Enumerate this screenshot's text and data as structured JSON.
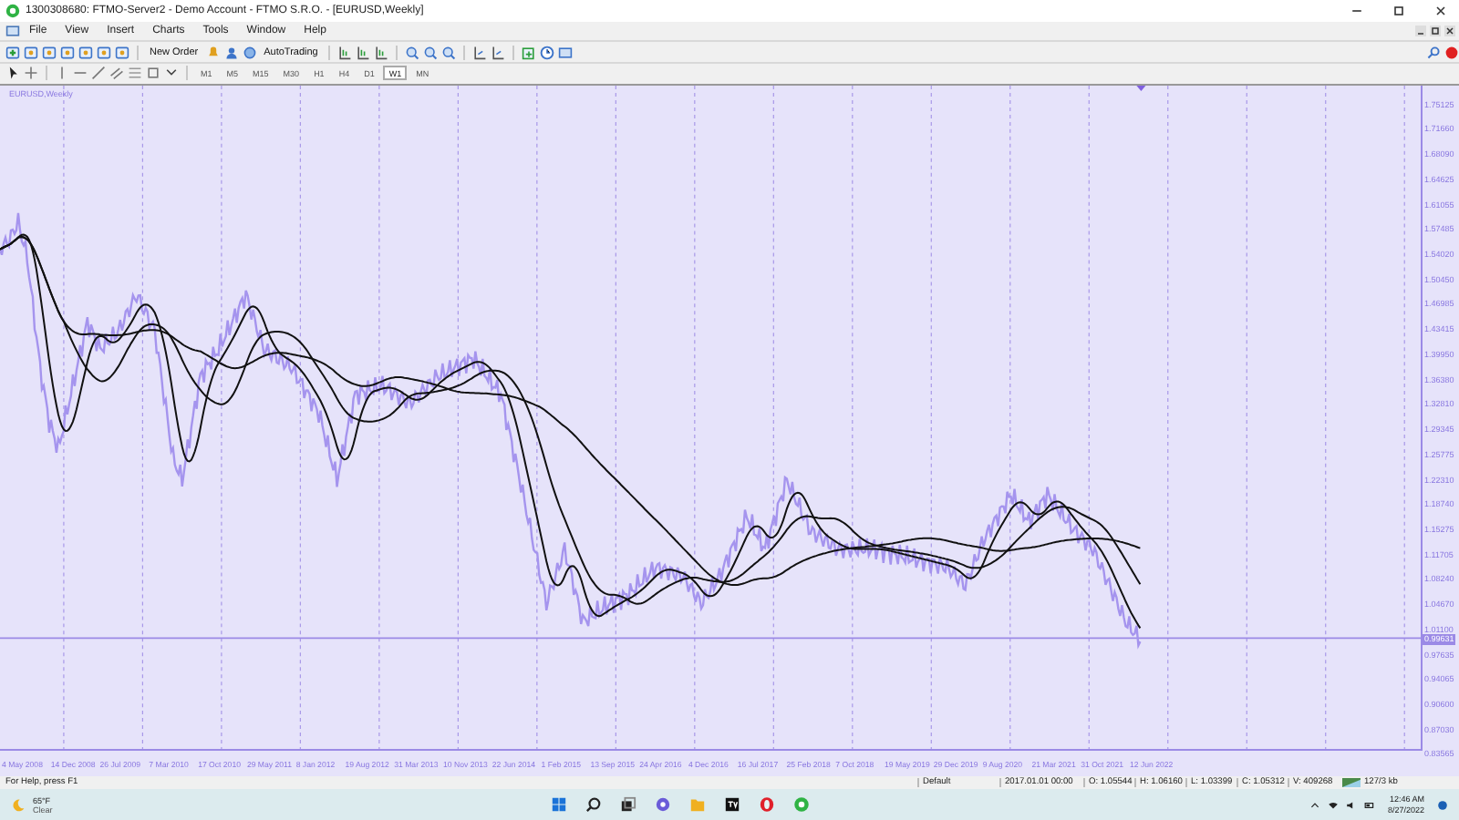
{
  "window": {
    "title": "1300308680: FTMO-Server2 - Demo Account - FTMO S.R.O. - [EURUSD,Weekly]"
  },
  "menu": [
    "File",
    "View",
    "Insert",
    "Charts",
    "Tools",
    "Window",
    "Help"
  ],
  "toolbar": {
    "new_order": "New Order",
    "auto_trading": "AutoTrading"
  },
  "timeframes": [
    {
      "label": "M1",
      "selected": false
    },
    {
      "label": "M5",
      "selected": false
    },
    {
      "label": "M15",
      "selected": false
    },
    {
      "label": "M30",
      "selected": false
    },
    {
      "label": "H1",
      "selected": false
    },
    {
      "label": "H4",
      "selected": false
    },
    {
      "label": "D1",
      "selected": false
    },
    {
      "label": "W1",
      "selected": true
    },
    {
      "label": "MN",
      "selected": false
    }
  ],
  "chart": {
    "symbol_label": "EURUSD,Weekly",
    "price_labels": [
      "1.75125",
      "1.71660",
      "1.68090",
      "1.64625",
      "1.61055",
      "1.57485",
      "1.54020",
      "1.50450",
      "1.46985",
      "1.43415",
      "1.39950",
      "1.36380",
      "1.32810",
      "1.29345",
      "1.25775",
      "1.22310",
      "1.18740",
      "1.15275",
      "1.11705",
      "1.08240",
      "1.04670",
      "1.01100",
      "0.97635",
      "0.94065",
      "0.90600",
      "0.87030",
      "0.83565"
    ],
    "current_price": "0.99631",
    "date_labels": [
      "4 May 2008",
      "14 Dec 2008",
      "26 Jul 2009",
      "7 Mar 2010",
      "17 Oct 2010",
      "29 May 2011",
      "8 Jan 2012",
      "19 Aug 2012",
      "31 Mar 2013",
      "10 Nov 2013",
      "22 Jun 2014",
      "1 Feb 2015",
      "13 Sep 2015",
      "24 Apr 2016",
      "4 Dec 2016",
      "16 Jul 2017",
      "25 Feb 2018",
      "7 Oct 2018",
      "19 May 2019",
      "29 Dec 2019",
      "9 Aug 2020",
      "21 Mar 2021",
      "31 Oct 2021",
      "12 Jun 2022"
    ]
  },
  "status_bar": {
    "help": "For Help, press F1",
    "profile": "Default",
    "datetime": "2017.01.01 00:00",
    "open": "O: 1.05544",
    "high": "H: 1.06160",
    "low": "L: 1.03399",
    "close": "C: 1.05312",
    "volume": "V: 409268",
    "traffic": "127/3 kb"
  },
  "taskbar": {
    "temperature": "65°F",
    "condition": "Clear",
    "time": "12:46 AM",
    "date": "8/27/2022"
  }
}
